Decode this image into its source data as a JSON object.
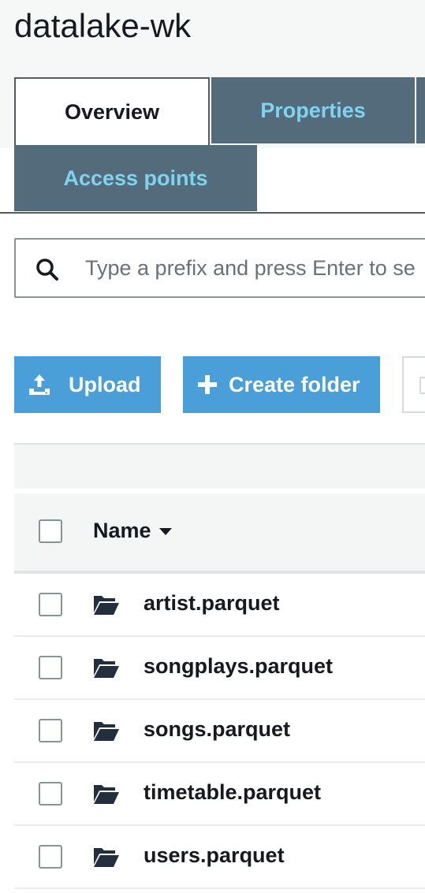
{
  "bucket": {
    "title": "datalake-wk"
  },
  "tabs": [
    {
      "label": "Overview",
      "active": true
    },
    {
      "label": "Properties",
      "active": false
    },
    {
      "label": "Access points",
      "active": false
    }
  ],
  "search": {
    "placeholder": "Type a prefix and press Enter to search. Press ESC to clear.",
    "value": ""
  },
  "toolbar": {
    "upload_label": "Upload",
    "create_folder_label": "Create folder"
  },
  "table": {
    "columns": [
      {
        "label": "Name",
        "sort": "descending"
      }
    ],
    "rows": [
      {
        "name": "artist.parquet",
        "type": "folder"
      },
      {
        "name": "songplays.parquet",
        "type": "folder"
      },
      {
        "name": "songs.parquet",
        "type": "folder"
      },
      {
        "name": "timetable.parquet",
        "type": "folder"
      },
      {
        "name": "users.parquet",
        "type": "folder"
      }
    ]
  },
  "icons": {
    "search": "search-icon",
    "upload": "upload-icon",
    "create": "plus-icon",
    "sort": "caret-down-icon",
    "folder": "folder-open-icon"
  },
  "colors": {
    "accent_button": "#4a9fd8",
    "inactive_tab_bg": "#546b7c",
    "inactive_tab_text": "#7fd3ef",
    "text": "#16191f"
  }
}
